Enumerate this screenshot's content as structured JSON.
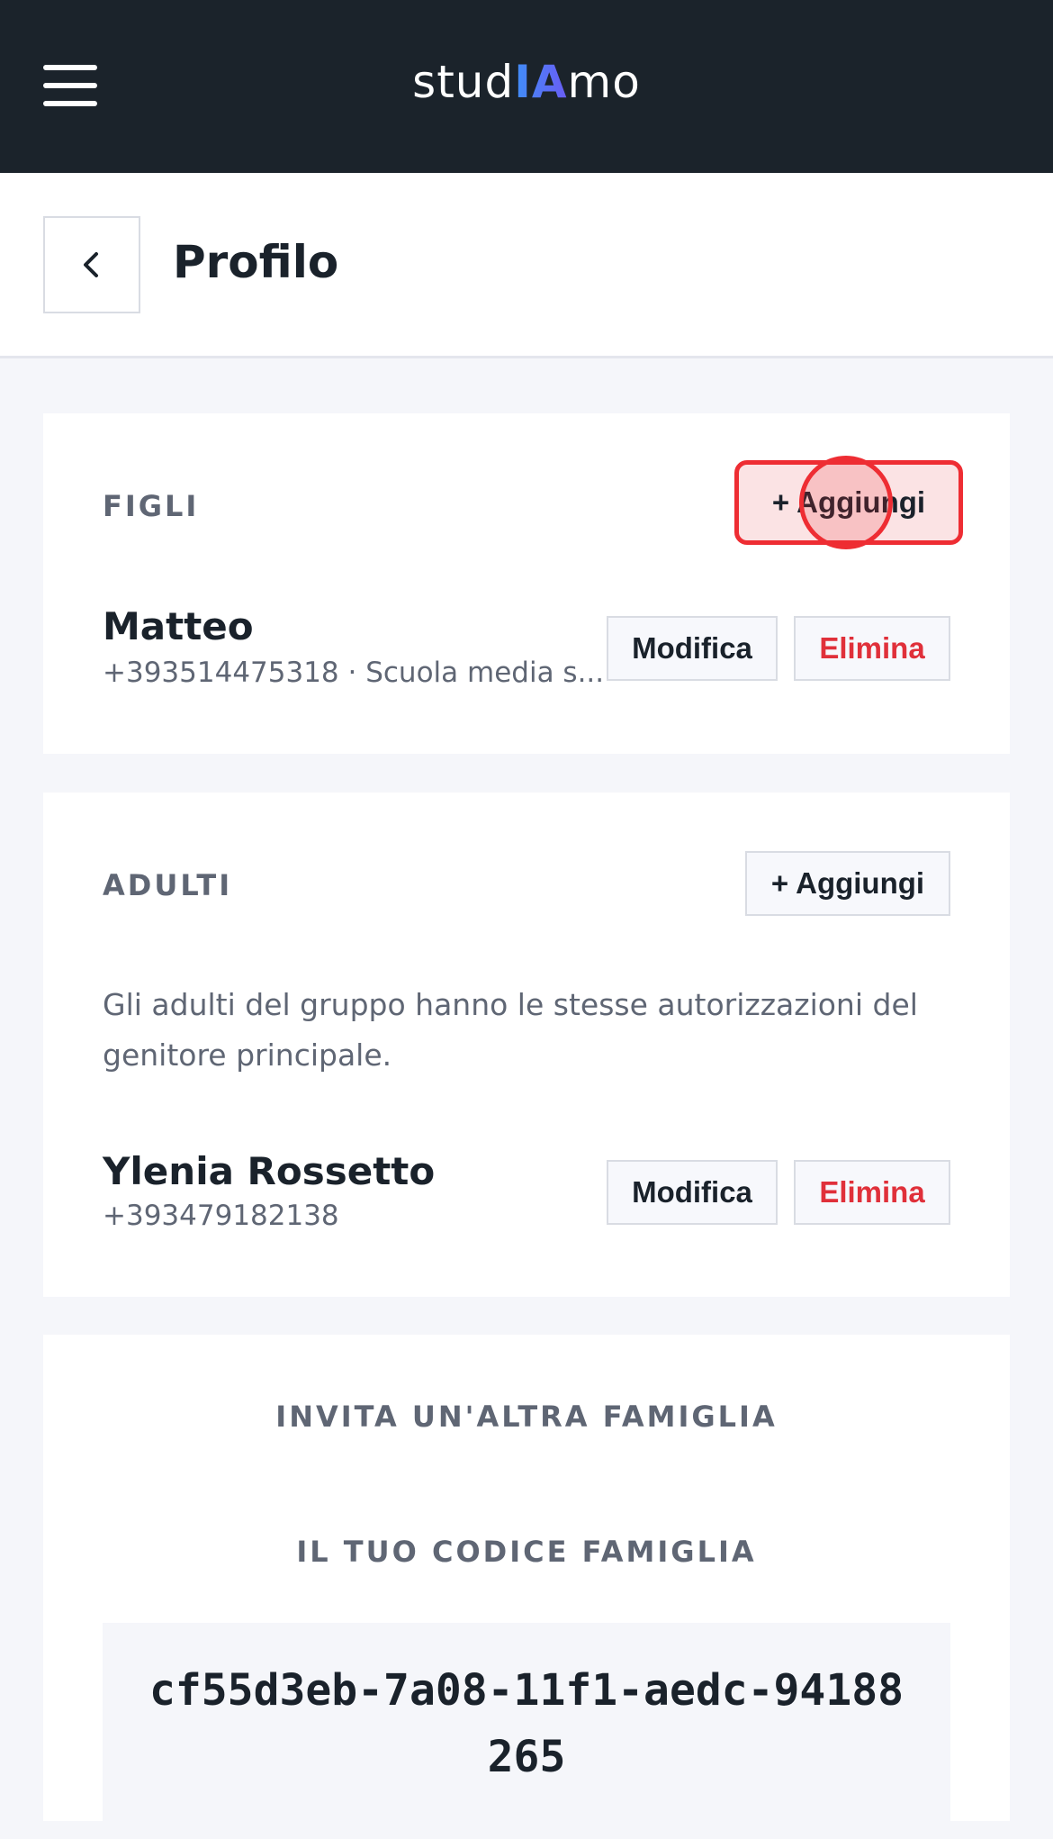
{
  "header": {
    "brand_prefix": "stud",
    "brand_highlight": "IA",
    "brand_suffix": "mo",
    "menu_icon": "hamburger-menu-icon"
  },
  "page": {
    "title": "Profilo",
    "back_icon": "chevron-left-icon"
  },
  "children": {
    "label": "FIGLI",
    "add_label": "+ Aggiungi",
    "items": [
      {
        "name": "Matteo",
        "subtitle": "+393514475318 · Scuola media s...",
        "edit_label": "Modifica",
        "delete_label": "Elimina"
      }
    ]
  },
  "adults": {
    "label": "ADULTI",
    "add_label": "+ Aggiungi",
    "description": "Gli adulti del gruppo hanno le stesse autorizzazioni del genitore principale.",
    "items": [
      {
        "name": "Ylenia Rossetto",
        "subtitle": "+393479182138",
        "edit_label": "Modifica",
        "delete_label": "Elimina"
      }
    ]
  },
  "invite": {
    "label": "INVITA UN'ALTRA FAMIGLIA",
    "code_label": "IL TUO CODICE FAMIGLIA",
    "code": "cf55d3eb-7a08-11f1-aedc-94188265"
  },
  "colors": {
    "topbar": "#1b232b",
    "danger": "#e0303a",
    "highlight": "#ee2d33",
    "brand_gradient_start": "#3f8ef7",
    "brand_gradient_end": "#6a5cf5"
  }
}
